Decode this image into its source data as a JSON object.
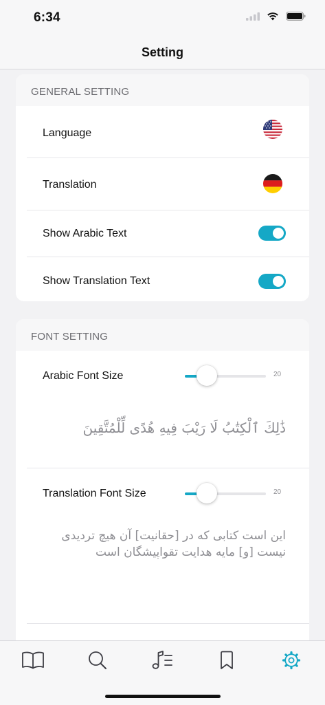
{
  "status_bar": {
    "time": "6:34"
  },
  "nav": {
    "title": "Setting"
  },
  "general": {
    "header": "GENERAL SETTING",
    "language_label": "Language",
    "translation_label": "Translation",
    "show_arabic_label": "Show Arabic Text",
    "show_arabic_on": true,
    "show_translation_label": "Show Translation Text",
    "show_translation_on": true
  },
  "font": {
    "header": "FONT SETTING",
    "arabic_label": "Arabic Font Size",
    "arabic_value": "20",
    "arabic_preview": "ذَٰلِكَ ٱلْكِتَٰبُ لَا رَيْبَ فِيهِ هُدًى لِّلْمُتَّقِينَ",
    "translation_label": "Translation Font Size",
    "translation_value": "20",
    "translation_preview": "این است کتابی که در [حقانیت] آن هیچ تردیدی نیست [و] مایه هدایت تقواپیشگان است"
  },
  "colors": {
    "accent": "#15a8c6",
    "tab_inactive": "#3c3c43"
  },
  "tab_bar": {
    "items": [
      {
        "icon": "book-icon",
        "active": false
      },
      {
        "icon": "search-icon",
        "active": false
      },
      {
        "icon": "music-list-icon",
        "active": false
      },
      {
        "icon": "bookmark-icon",
        "active": false
      },
      {
        "icon": "gear-icon",
        "active": true
      }
    ]
  }
}
